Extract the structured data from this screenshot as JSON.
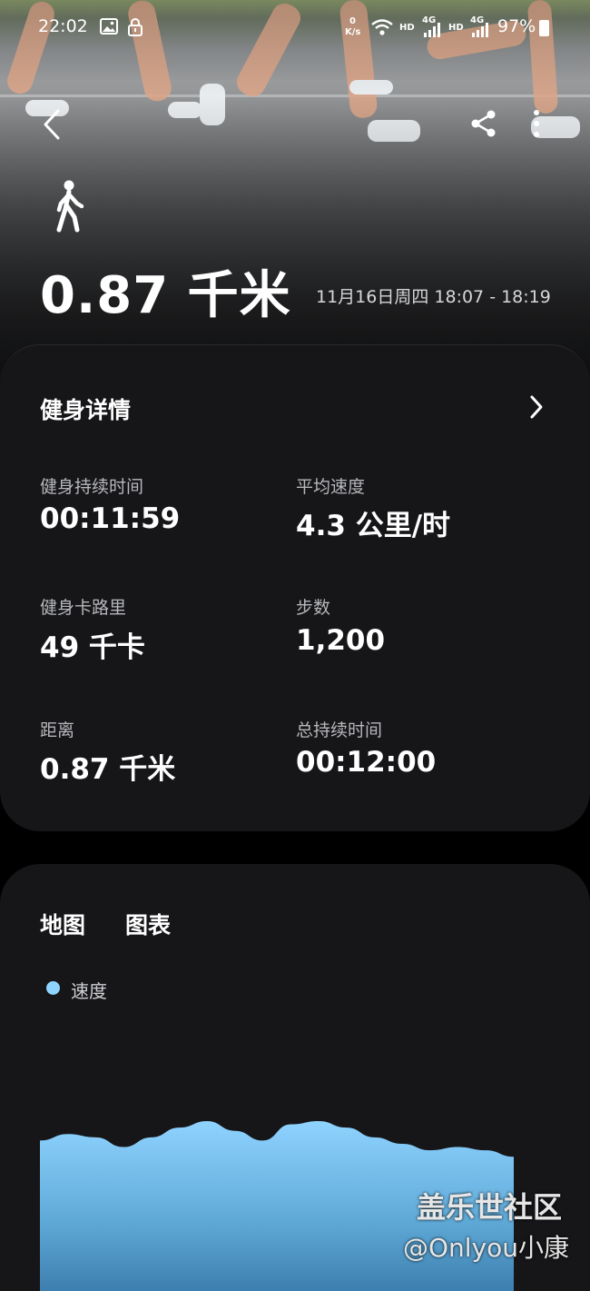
{
  "status_bar": {
    "time": "22:02",
    "net_speed_top": "0",
    "net_speed_unit": "K/s",
    "hd1": "HD",
    "net1": "4G",
    "hd2": "HD",
    "net2": "4G",
    "battery": "97%"
  },
  "header": {
    "back_icon": "chevron-left-icon",
    "share_icon": "share-icon",
    "more_icon": "more-vertical-icon",
    "activity_icon": "walking-icon",
    "distance": "0.87 千米",
    "datetime": "11月16日周四 18:07 - 18:19"
  },
  "details": {
    "title": "健身详情",
    "stats": [
      {
        "label": "健身持续时间",
        "value": "00:11:59"
      },
      {
        "label": "平均速度",
        "value": "4.3 公里/时"
      },
      {
        "label": "健身卡路里",
        "value": "49 千卡"
      },
      {
        "label": "步数",
        "value": "1,200"
      },
      {
        "label": "距离",
        "value": "0.87 千米"
      },
      {
        "label": "总持续时间",
        "value": "00:12:00"
      }
    ]
  },
  "chart_section": {
    "tabs": [
      "地图",
      "图表"
    ],
    "legend": "速度",
    "accent": "#8fd3ff"
  },
  "chart_data": {
    "type": "area",
    "series": [
      {
        "name": "速度",
        "values": [
          5.2,
          5.4,
          5.3,
          5.0,
          5.3,
          5.6,
          5.8,
          5.5,
          5.2,
          5.7,
          5.8,
          5.6,
          5.3,
          5.1,
          4.9,
          5.0,
          4.9,
          4.7
        ]
      }
    ]
  },
  "watermark": {
    "line1": "盖乐世社区",
    "line2": "@Onlyou小康"
  }
}
